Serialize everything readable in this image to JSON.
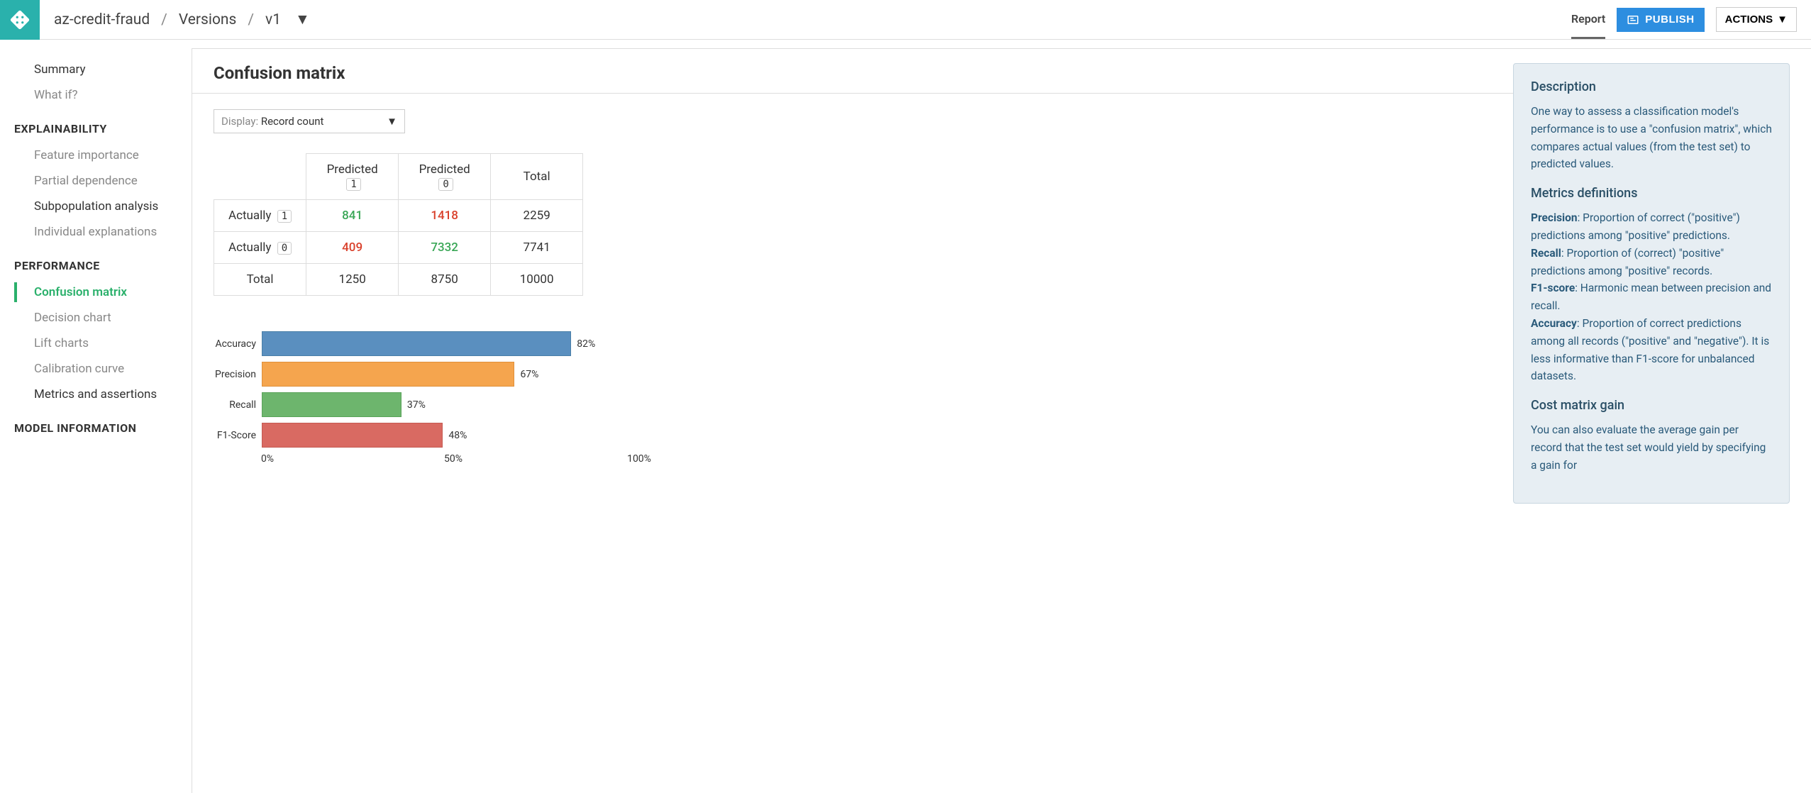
{
  "header": {
    "breadcrumb": [
      "az-credit-fraud",
      "Versions",
      "v1"
    ],
    "report": "Report",
    "publish": "PUBLISH",
    "actions": "ACTIONS"
  },
  "sidebar": {
    "top_items": [
      {
        "label": "Summary",
        "dark": true
      },
      {
        "label": "What if?",
        "dark": false
      }
    ],
    "sections": [
      {
        "heading": "EXPLAINABILITY",
        "items": [
          {
            "label": "Feature importance",
            "dark": false
          },
          {
            "label": "Partial dependence",
            "dark": false
          },
          {
            "label": "Subpopulation analysis",
            "dark": true
          },
          {
            "label": "Individual explanations",
            "dark": false
          }
        ]
      },
      {
        "heading": "PERFORMANCE",
        "items": [
          {
            "label": "Confusion matrix",
            "active": true,
            "dark": true
          },
          {
            "label": "Decision chart",
            "dark": false
          },
          {
            "label": "Lift charts",
            "dark": false
          },
          {
            "label": "Calibration curve",
            "dark": false
          },
          {
            "label": "Metrics and assertions",
            "dark": true
          }
        ]
      },
      {
        "heading": "MODEL INFORMATION",
        "items": []
      }
    ]
  },
  "main": {
    "title": "Confusion matrix",
    "display_label": "Display:",
    "display_value": "Record count",
    "table": {
      "col_predicted": "Predicted",
      "col_total": "Total",
      "row_actually": "Actually",
      "row_total": "Total",
      "class1": "1",
      "class0": "0",
      "cells": {
        "a1p1": "841",
        "a1p0": "1418",
        "a1t": "2259",
        "a0p1": "409",
        "a0p0": "7332",
        "a0t": "7741",
        "tp1": "1250",
        "tp0": "8750",
        "tt": "10000"
      }
    },
    "axis": {
      "t0": "0%",
      "t50": "50%",
      "t100": "100%"
    }
  },
  "chart_data": {
    "type": "bar",
    "orientation": "horizontal",
    "categories": [
      "Accuracy",
      "Precision",
      "Recall",
      "F1-Score"
    ],
    "values": [
      82,
      67,
      37,
      48
    ],
    "value_labels": [
      "82%",
      "67%",
      "37%",
      "48%"
    ],
    "colors": [
      "blue",
      "orange",
      "green",
      "red"
    ],
    "xlim": [
      0,
      100
    ],
    "xlabel": "",
    "ylabel": "",
    "xticks": [
      "0%",
      "50%",
      "100%"
    ]
  },
  "info": {
    "desc_h": "Description",
    "desc_p": "One way to assess a classification model's performance is to use a \"confusion matrix\", which compares actual values (from the test set) to predicted values.",
    "met_h": "Metrics definitions",
    "defs": [
      {
        "term": "Precision",
        "text": ": Proportion of correct (\"positive\") predictions among \"positive\" predictions."
      },
      {
        "term": "Recall",
        "text": ": Proportion of (correct) \"positive\" predictions among \"positive\" records."
      },
      {
        "term": "F1-score",
        "text": ": Harmonic mean between precision and recall."
      },
      {
        "term": "Accuracy",
        "text": ": Proportion of correct predictions among all records (\"positive\" and \"negative\"). It is less informative than F1-score for unbalanced datasets."
      }
    ],
    "cost_h": "Cost matrix gain",
    "cost_p": "You can also evaluate the average gain per record that the test set would yield by specifying a gain for"
  }
}
